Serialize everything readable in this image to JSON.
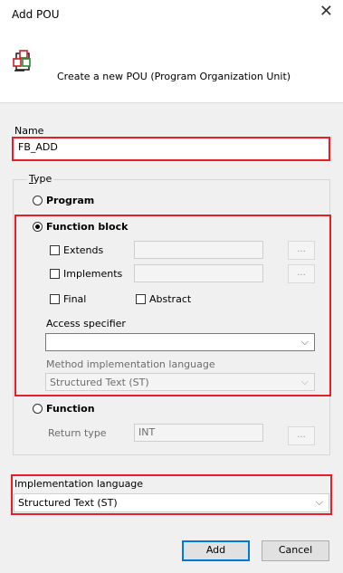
{
  "dialog": {
    "title": "Add POU",
    "close_glyph": "✕",
    "description": "Create a new POU (Program Organization Unit)",
    "header_icon": "pou-icon"
  },
  "name_field": {
    "label": "Name",
    "value": "FB_ADD"
  },
  "type_group": {
    "label": "Type",
    "program_label": "Program",
    "function_block_label": "Function block",
    "function_label": "Function",
    "selected": "Function block"
  },
  "function_block": {
    "extends_label": "Extends",
    "implements_label": "Implements",
    "final_label": "Final",
    "abstract_label": "Abstract",
    "browse_label": "...",
    "access_specifier_label": "Access specifier",
    "access_specifier_value": "",
    "method_lang_label": "Method implementation language",
    "method_lang_value": "Structured Text (ST)"
  },
  "function": {
    "return_type_label": "Return type",
    "return_type_value": "INT",
    "browse_label": "..."
  },
  "impl_language": {
    "label": "Implementation language",
    "value": "Structured Text (ST)"
  },
  "buttons": {
    "add": "Add",
    "cancel": "Cancel"
  },
  "colors": {
    "highlight": "#e41e2a",
    "primary_border": "#0078d7"
  }
}
